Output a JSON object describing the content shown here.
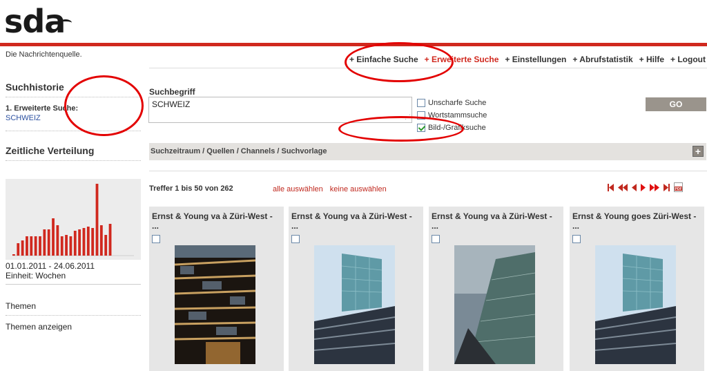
{
  "brand": {
    "logo": "sda",
    "tagline": "Die Nachrichtenquelle."
  },
  "nav": {
    "items": [
      {
        "label": "+ Einfache Suche",
        "active": false
      },
      {
        "label": "+ Erweiterte Suche",
        "active": true
      },
      {
        "label": "+ Einstellungen",
        "active": false
      },
      {
        "label": "+ Abrufstatistik",
        "active": false
      },
      {
        "label": "+ Hilfe",
        "active": false
      },
      {
        "label": "+ Logout",
        "active": false
      }
    ]
  },
  "sidebar": {
    "history_title": "Suchhistorie",
    "history_entry_label": "1. Erweiterte Suche:",
    "history_entry_query": "SCHWEIZ",
    "distribution_title": "Zeitliche Verteilung",
    "distribution_range": "01.01.2011 - 24.06.2011",
    "distribution_unit": "Einheit: Wochen",
    "themes_title": "Themen",
    "themes_link": "Themen anzeigen"
  },
  "chart_data": {
    "type": "bar",
    "color": "#d0281e",
    "values": [
      1,
      9,
      11,
      14,
      14,
      14,
      14,
      19,
      19,
      27,
      22,
      14,
      15,
      14,
      18,
      19,
      20,
      21,
      20,
      52,
      22,
      15,
      23
    ]
  },
  "search": {
    "label": "Suchbegriff",
    "value": "SCHWEIZ",
    "options": [
      {
        "label": "Unscharfe Suche",
        "checked": false
      },
      {
        "label": "Wortstammsuche",
        "checked": false
      },
      {
        "label": "Bild-/Grafiksuche",
        "checked": true
      }
    ],
    "go_label": "GO",
    "options_bar": "Suchzeitraum / Quellen / Channels / Suchvorlage",
    "expand_label": "+"
  },
  "results": {
    "summary": "Treffer 1 bis 50 von 262",
    "select_all": "alle auswählen",
    "select_none": "keine auswählen",
    "cards": [
      {
        "title": "Ernst & Young va à Züri-West - ..."
      },
      {
        "title": "Ernst & Young va à Züri-West - ..."
      },
      {
        "title": "Ernst & Young va à Züri-West - ..."
      },
      {
        "title": "Ernst & Young goes Züri-West - ..."
      }
    ]
  },
  "colors": {
    "accent": "#d0281e",
    "link": "#2a4fa0",
    "button": "#9a948c",
    "annotation": "#e30000"
  }
}
